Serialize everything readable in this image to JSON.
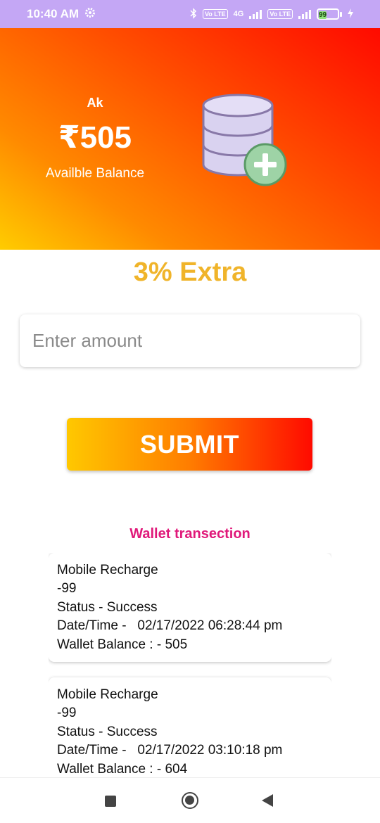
{
  "status_bar": {
    "time": "10:40 AM",
    "battery": "99",
    "net_4g": "4G",
    "volte": "Vo LTE"
  },
  "wallet": {
    "user_name": "Ak",
    "currency_symbol": "₹",
    "balance": "505",
    "balance_label": "Availble Balance",
    "icon": "database-add-icon"
  },
  "offer": {
    "text": "3% Extra"
  },
  "form": {
    "amount_placeholder": "Enter amount",
    "submit_label": "SUBMIT"
  },
  "transactions": {
    "title": "Wallet transection",
    "items": [
      {
        "type": "Mobile Recharge",
        "amount": "-99",
        "status": "Status - Success",
        "datetime": "Date/Time -   02/17/2022 06:28:44 pm",
        "wallet_balance": "Wallet Balance : - 505"
      },
      {
        "type": "Mobile Recharge",
        "amount": "-99",
        "status": "Status - Success",
        "datetime": "Date/Time -   02/17/2022 03:10:18 pm",
        "wallet_balance": "Wallet Balance : - 604"
      }
    ]
  },
  "colors": {
    "status_bar": "#c4a7f5",
    "gradient_start": "#ffcc00",
    "gradient_end": "#ff0a00",
    "offer_text": "#f0b42a",
    "section_title": "#e0197a"
  }
}
